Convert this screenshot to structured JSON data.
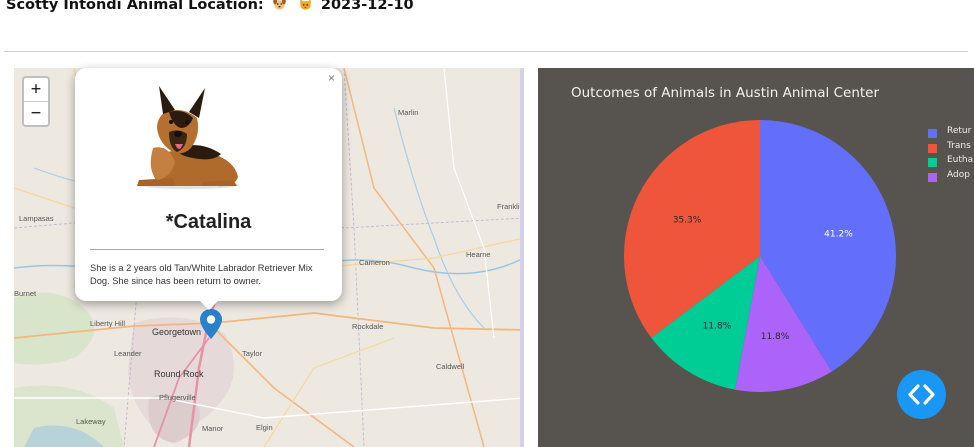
{
  "header": {
    "title": "Scotty Intondi Animal Location:",
    "dog_emoji": "dog-face-emoji",
    "cat_emoji": "cat-face-emoji",
    "date": "2023-12-10"
  },
  "map": {
    "zoom_in": "+",
    "zoom_out": "−",
    "labels": {
      "marlin": "Marlin",
      "lampasas": "Lampasas",
      "franklin": "Frankli",
      "cameron": "Cameron",
      "hearne": "Hearne",
      "burnet": "Burnet",
      "liberty_hill": "Liberty Hill",
      "georgetown": "Georgetown",
      "rockdale": "Rockdale",
      "leander": "Leander",
      "taylor": "Taylor",
      "round_rock": "Round Rock",
      "caldwell": "Caldwell",
      "pflugerville": "Pflugerville",
      "lakeway": "Lakeway",
      "manor": "Manor",
      "elgin": "Elgin"
    },
    "popup": {
      "close": "×",
      "name": "*Catalina",
      "description": "She is a 2 years old Tan/White Labrador Retriever Mix Dog. She since has been return to owner."
    }
  },
  "chart_data": {
    "type": "pie",
    "title": "Outcomes of Animals in Austin Animal Center",
    "labels": [
      "Retur",
      "Trans",
      "Eutha",
      "Adop"
    ],
    "values": [
      41.2,
      35.3,
      11.8,
      11.8
    ],
    "percent_labels": [
      "41.2%",
      "35.3%",
      "11.8%",
      "11.8%"
    ],
    "slice_order_clockwise_from_top": [
      "Retur",
      "Adop",
      "Eutha",
      "Trans"
    ],
    "colors": [
      "#636efa",
      "#ef553b",
      "#00cc96",
      "#ab63fa"
    ],
    "legend": "right"
  },
  "nav_button": {
    "icon": "code-brackets-icon"
  },
  "colors": {
    "chart_bg": "#57534f",
    "nav_button": "#1a96f5",
    "marker": "#2a81cb"
  }
}
